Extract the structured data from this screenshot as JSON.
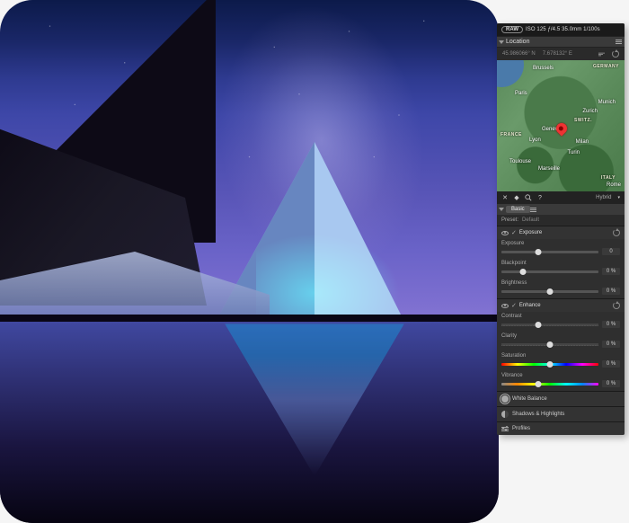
{
  "exif": {
    "raw_badge": "RAW",
    "text": "ISO 125 ƒ/4.5 35.0mm 1/100s"
  },
  "location": {
    "title": "Location",
    "lat": "45.986066° N",
    "lon": "7.678132° E",
    "map_cities": {
      "brussels": "Brussels",
      "paris": "Paris",
      "lyon": "Lyon",
      "toulouse": "Toulouse",
      "marseille": "Marseille",
      "geneva": "Geneva",
      "zurich": "Zurich",
      "milan": "Milan",
      "turin": "Turin",
      "munich": "Munich",
      "rome": "Rome"
    },
    "map_countries": {
      "france": "FRANCE",
      "germany": "GERMANY",
      "switz": "SWITZ.",
      "italy": "ITALY"
    },
    "map_mode": "Hybrid"
  },
  "basic": {
    "tab_label": "Basic",
    "preset_label": "Preset:",
    "preset_value": "Default",
    "exposure_group": "Exposure",
    "enhance_group": "Enhance",
    "sliders": {
      "exposure": {
        "label": "Exposure",
        "value": "0",
        "pos": 38
      },
      "blackpoint": {
        "label": "Blackpoint",
        "value": "0 %",
        "pos": 22
      },
      "brightness": {
        "label": "Brightness",
        "value": "0 %",
        "pos": 50
      },
      "contrast": {
        "label": "Contrast",
        "value": "0 %",
        "pos": 38
      },
      "clarity": {
        "label": "Clarity",
        "value": "0 %",
        "pos": 50
      },
      "saturation": {
        "label": "Saturation",
        "value": "0 %",
        "pos": 50
      },
      "vibrance": {
        "label": "Vibrance",
        "value": "0 %",
        "pos": 38
      }
    },
    "collapsed": {
      "white_balance": "White Balance",
      "shadows_highlights": "Shadows & Highlights",
      "profiles": "Profiles"
    }
  }
}
